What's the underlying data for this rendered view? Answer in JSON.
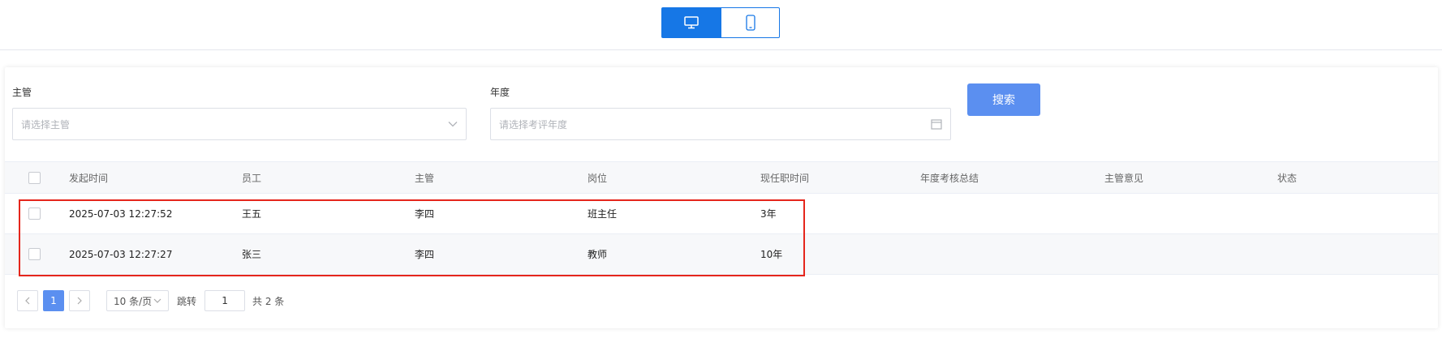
{
  "view_toggle": {
    "desktop_icon": "desktop-monitor-icon",
    "mobile_icon": "mobile-phone-icon",
    "active": "desktop"
  },
  "filters": {
    "supervisor_label": "主管",
    "supervisor_placeholder": "请选择主管",
    "year_label": "年度",
    "year_placeholder": "请选择考评年度",
    "search_label": "搜索"
  },
  "table": {
    "headers": [
      "发起时间",
      "员工",
      "主管",
      "岗位",
      "现任职时间",
      "年度考核总结",
      "主管意见",
      "状态"
    ],
    "rows": [
      [
        "2025-07-03 12:27:52",
        "王五",
        "李四",
        "班主任",
        "3年",
        "",
        "",
        ""
      ],
      [
        "2025-07-03 12:27:27",
        "张三",
        "李四",
        "教师",
        "10年",
        "",
        "",
        ""
      ]
    ]
  },
  "pagination": {
    "current_page": "1",
    "page_size": "10 条/页",
    "jump_label": "跳转",
    "jump_value": "1",
    "total": "共 2 条"
  },
  "colors": {
    "primary": "#1677e6",
    "button": "#5b8ff0",
    "highlight": "#e5261c"
  }
}
